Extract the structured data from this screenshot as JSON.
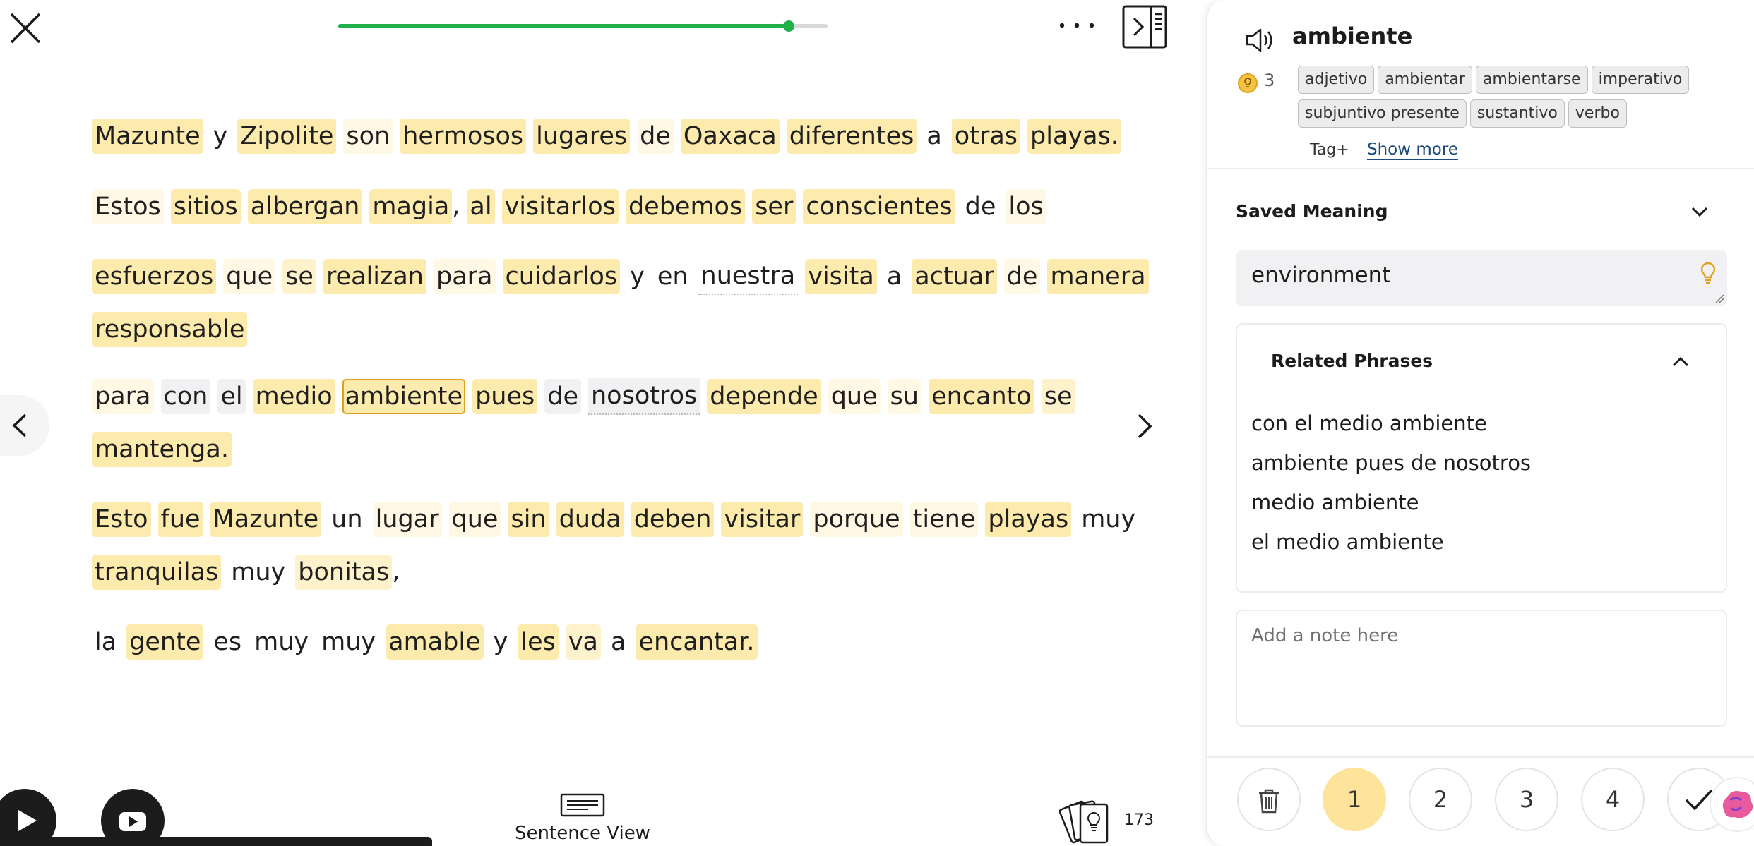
{
  "topbar": {
    "progress_fraction": 0.92,
    "colors": {
      "progress": "#21b14a",
      "track": "#d9d9d9"
    },
    "icons": {
      "close": "close-icon",
      "more": "more-horizontal-icon",
      "sidebar": "sidebar-toggle-icon"
    }
  },
  "reader": {
    "lines": [
      [
        {
          "t": "Mazunte",
          "h": "lvl1",
          "p": ""
        },
        {
          "t": "y",
          "h": "",
          "p": ""
        },
        {
          "t": "Zipolite",
          "h": "lvl1",
          "p": ""
        },
        {
          "t": "son",
          "h": "lvl3",
          "p": ""
        },
        {
          "t": "hermosos",
          "h": "lvl1",
          "p": ""
        },
        {
          "t": "lugares",
          "h": "lvl1",
          "p": ""
        },
        {
          "t": "de",
          "h": "lvl3",
          "p": ""
        },
        {
          "t": "Oaxaca",
          "h": "lvl1",
          "p": ""
        },
        {
          "t": "diferentes",
          "h": "lvl1",
          "p": ""
        },
        {
          "t": "a",
          "h": "",
          "p": ""
        },
        {
          "t": "otras",
          "h": "lvl1",
          "p": ""
        },
        {
          "t": "playas.",
          "h": "lvl1",
          "p": ""
        }
      ],
      [
        {
          "t": "Estos",
          "h": "lvl3",
          "p": ""
        },
        {
          "t": "sitios",
          "h": "lvl1",
          "p": ""
        },
        {
          "t": "albergan",
          "h": "lvl1",
          "p": ""
        },
        {
          "t": "magia",
          "h": "lvl1",
          "p": ","
        },
        {
          "t": "al",
          "h": "lvl1",
          "p": ""
        },
        {
          "t": "visitarlos",
          "h": "lvl1",
          "p": ""
        },
        {
          "t": "debemos",
          "h": "lvl1",
          "p": ""
        },
        {
          "t": "ser",
          "h": "lvl1",
          "p": ""
        },
        {
          "t": "conscientes",
          "h": "lvl1",
          "p": ""
        },
        {
          "t": "de",
          "h": "",
          "p": ""
        },
        {
          "t": "los",
          "h": "lvl3",
          "p": ""
        }
      ],
      [
        {
          "t": "esfuerzos",
          "h": "lvl1",
          "p": ""
        },
        {
          "t": "que",
          "h": "lvl3",
          "p": ""
        },
        {
          "t": "se",
          "h": "lvl2",
          "p": ""
        },
        {
          "t": "realizan",
          "h": "lvl1",
          "p": ""
        },
        {
          "t": "para",
          "h": "lvl3",
          "p": ""
        },
        {
          "t": "cuidarlos",
          "h": "lvl1",
          "p": ""
        },
        {
          "t": "y",
          "h": "",
          "p": ""
        },
        {
          "t": "en",
          "h": "",
          "p": ""
        },
        {
          "t": "nuestra",
          "h": "dotted",
          "p": ""
        },
        {
          "t": "visita",
          "h": "lvl1",
          "p": ""
        },
        {
          "t": "a",
          "h": "",
          "p": ""
        },
        {
          "t": "actuar",
          "h": "lvl1",
          "p": ""
        },
        {
          "t": "de",
          "h": "lvl3",
          "p": ""
        },
        {
          "t": "manera",
          "h": "lvl1",
          "p": ""
        }
      ],
      [
        {
          "t": "responsable",
          "h": "lvl1",
          "p": ""
        }
      ],
      [
        {
          "t": "para",
          "h": "lvl3",
          "p": ""
        },
        {
          "t": "con",
          "h": "phr",
          "p": ""
        },
        {
          "t": "el",
          "h": "phr",
          "p": ""
        },
        {
          "t": "medio",
          "h": "lvl1",
          "p": ""
        },
        {
          "t": "ambiente",
          "h": "sel",
          "p": ""
        },
        {
          "t": "pues",
          "h": "lvl1",
          "p": ""
        },
        {
          "t": "de",
          "h": "phr",
          "p": ""
        },
        {
          "t": "nosotros",
          "h": "phr dotted",
          "p": ""
        },
        {
          "t": "depende",
          "h": "lvl1",
          "p": ""
        },
        {
          "t": "que",
          "h": "lvl3",
          "p": ""
        },
        {
          "t": "su",
          "h": "lvl3",
          "p": ""
        },
        {
          "t": "encanto",
          "h": "lvl1",
          "p": ""
        },
        {
          "t": "se",
          "h": "lvl2",
          "p": ""
        }
      ],
      [
        {
          "t": "mantenga.",
          "h": "lvl1",
          "p": ""
        }
      ],
      [
        {
          "t": "Esto",
          "h": "lvl1",
          "p": ""
        },
        {
          "t": "fue",
          "h": "lvl1",
          "p": ""
        },
        {
          "t": "Mazunte",
          "h": "lvl1",
          "p": ""
        },
        {
          "t": "un",
          "h": "",
          "p": ""
        },
        {
          "t": "lugar",
          "h": "lvl3",
          "p": ""
        },
        {
          "t": "que",
          "h": "lvl3",
          "p": ""
        },
        {
          "t": "sin",
          "h": "lvl1",
          "p": ""
        },
        {
          "t": "duda",
          "h": "lvl1",
          "p": ""
        },
        {
          "t": "deben",
          "h": "lvl1",
          "p": ""
        },
        {
          "t": "visitar",
          "h": "lvl1",
          "p": ""
        },
        {
          "t": "porque",
          "h": "lvl3",
          "p": ""
        },
        {
          "t": "tiene",
          "h": "lvl3",
          "p": ""
        },
        {
          "t": "playas",
          "h": "lvl1",
          "p": ""
        },
        {
          "t": "muy",
          "h": "",
          "p": ""
        }
      ],
      [
        {
          "t": "tranquilas",
          "h": "lvl1",
          "p": ""
        },
        {
          "t": "muy",
          "h": "",
          "p": ""
        },
        {
          "t": "bonitas",
          "h": "lvl2",
          "p": ","
        }
      ],
      [
        {
          "t": "la",
          "h": "",
          "p": ""
        },
        {
          "t": "gente",
          "h": "lvl1",
          "p": ""
        },
        {
          "t": "es",
          "h": "",
          "p": ""
        },
        {
          "t": "muy",
          "h": "",
          "p": ""
        },
        {
          "t": "muy",
          "h": "",
          "p": ""
        },
        {
          "t": "amable",
          "h": "lvl1",
          "p": ""
        },
        {
          "t": "y",
          "h": "",
          "p": ""
        },
        {
          "t": "les",
          "h": "lvl1",
          "p": ""
        },
        {
          "t": "va",
          "h": "lvl2",
          "p": ""
        },
        {
          "t": "a",
          "h": "",
          "p": ""
        },
        {
          "t": "encantar.",
          "h": "lvl1",
          "p": ""
        }
      ]
    ],
    "colors": {
      "lvl1": "#fdebad",
      "lvl2": "#fef2cc",
      "lvl3": "#fff8e5",
      "phrase": "#f1f1f3",
      "selected_border": "#e0a020"
    }
  },
  "nav": {
    "prev_icon": "chevron-left-icon",
    "next_icon": "chevron-right-icon"
  },
  "bottombar": {
    "sentence_view_label": "Sentence View",
    "cards_count": "173",
    "icons": {
      "play": "play-icon",
      "youtube": "youtube-icon",
      "sentence": "sentence-view-icon",
      "cards": "flashcards-icon"
    }
  },
  "panel": {
    "term": "ambiente",
    "status_level": "3",
    "tags": [
      "adjetivo",
      "ambientar",
      "ambientarse",
      "imperativo",
      "subjuntivo presente",
      "sustantivo",
      "verbo"
    ],
    "tag_add_label": "Tag+",
    "show_more_label": "Show more",
    "saved_meaning_title": "Saved Meaning",
    "saved_meaning_value": "environment",
    "related_title": "Related Phrases",
    "related_phrases": [
      "con el medio ambiente",
      "ambiente pues de nosotros",
      "medio ambiente",
      "el medio ambiente"
    ],
    "note_placeholder": "Add a note here",
    "status_buttons": [
      "1",
      "2",
      "3",
      "4"
    ],
    "active_status": "1",
    "colors": {
      "status_active": "#fde49a",
      "bulb": "#e0a020"
    }
  }
}
